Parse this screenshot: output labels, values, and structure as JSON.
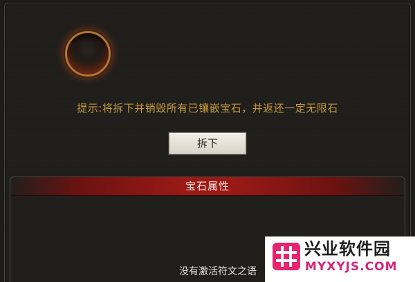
{
  "panel": {
    "hint_text": "提示:将拆下并销毁所有已镶嵌宝石，并返还一定无限石",
    "remove_button_label": "拆下"
  },
  "gem_attributes": {
    "title": "宝石属性",
    "empty_text": "没有激活符文之语"
  },
  "watermark": {
    "title": "兴业软件园",
    "url": "MYXYJS.COM",
    "logo_icon": "hash-grid-icon",
    "logo_color": "#e8246f"
  },
  "colors": {
    "hint": "#c59a3c",
    "header_red": "#9b1a16",
    "socket_rim": "#b07638"
  }
}
